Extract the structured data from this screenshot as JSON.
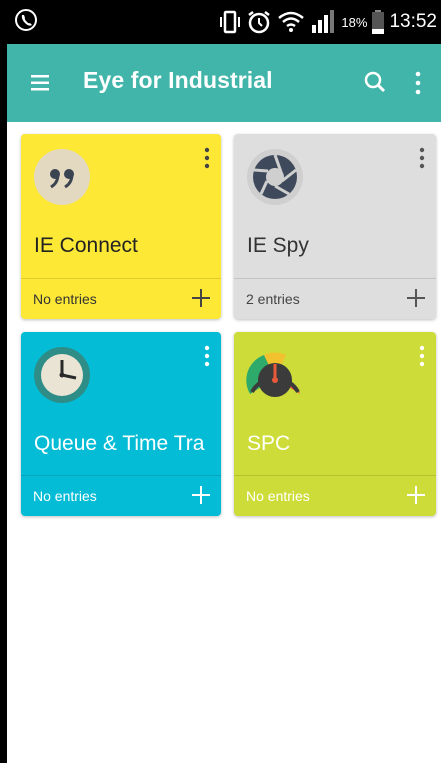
{
  "status_bar": {
    "battery": "18%",
    "time": "13:52"
  },
  "app_bar": {
    "title": "Eye for Industrial"
  },
  "cards": [
    {
      "name": "IE Connect",
      "entries": "No entries",
      "color": "#fde836"
    },
    {
      "name": "IE Spy",
      "entries": "2 entries",
      "color": "#dedede"
    },
    {
      "name": "Queue & Time Tra",
      "entries": "No entries",
      "color": "#04bcd6"
    },
    {
      "name": "SPC",
      "entries": "No entries",
      "color": "#cddc38"
    }
  ],
  "colors": {
    "app_bar": "#41b5a9",
    "status_bar": "#000000"
  }
}
